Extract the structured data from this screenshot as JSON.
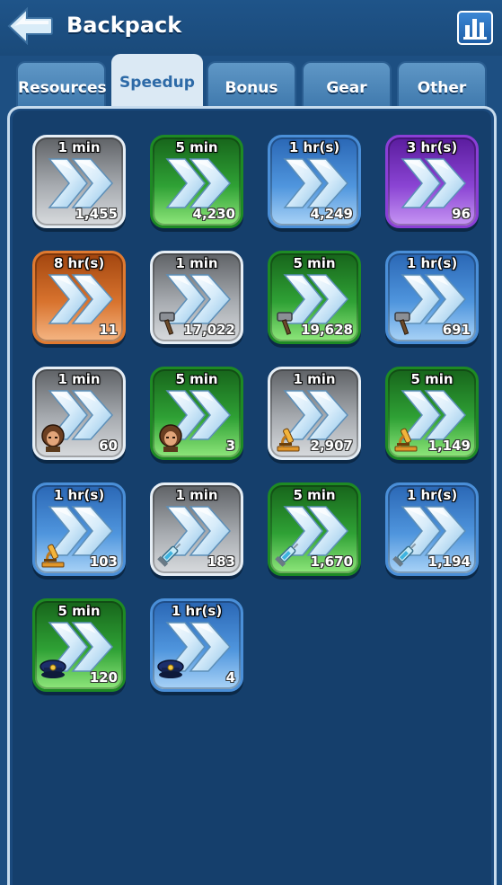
{
  "header": {
    "title": "Backpack",
    "back_icon": "back-arrow-icon",
    "stats_icon": "bar-chart-icon"
  },
  "tabs": [
    {
      "label": "Resources",
      "active": false
    },
    {
      "label": "Speedup",
      "active": true
    },
    {
      "label": "Bonus",
      "active": false
    },
    {
      "label": "Gear",
      "active": false
    },
    {
      "label": "Other",
      "active": false
    }
  ],
  "colors": {
    "gray": "#a7abb0",
    "green": "#2fa135",
    "blue": "#4f95dd",
    "purple": "#8a44d3",
    "orange": "#d8732e",
    "background": "#153f6c"
  },
  "items": [
    {
      "duration": "1 min",
      "quantity": "1,455",
      "rarity": "gray",
      "type": "general"
    },
    {
      "duration": "5 min",
      "quantity": "4,230",
      "rarity": "green",
      "type": "general"
    },
    {
      "duration": "1 hr(s)",
      "quantity": "4,249",
      "rarity": "blue",
      "type": "general"
    },
    {
      "duration": "3 hr(s)",
      "quantity": "96",
      "rarity": "purple",
      "type": "general"
    },
    {
      "duration": "8 hr(s)",
      "quantity": "11",
      "rarity": "orange",
      "type": "general"
    },
    {
      "duration": "1 min",
      "quantity": "17,022",
      "rarity": "gray",
      "type": "hammer"
    },
    {
      "duration": "5 min",
      "quantity": "19,628",
      "rarity": "green",
      "type": "hammer"
    },
    {
      "duration": "1 hr(s)",
      "quantity": "691",
      "rarity": "blue",
      "type": "hammer"
    },
    {
      "duration": "1 min",
      "quantity": "60",
      "rarity": "gray",
      "type": "soldier"
    },
    {
      "duration": "5 min",
      "quantity": "3",
      "rarity": "green",
      "type": "soldier"
    },
    {
      "duration": "1 min",
      "quantity": "2,907",
      "rarity": "gray",
      "type": "microscope"
    },
    {
      "duration": "5 min",
      "quantity": "1,149",
      "rarity": "green",
      "type": "microscope"
    },
    {
      "duration": "1 hr(s)",
      "quantity": "103",
      "rarity": "blue",
      "type": "microscope"
    },
    {
      "duration": "1 min",
      "quantity": "183",
      "rarity": "gray",
      "type": "syringe"
    },
    {
      "duration": "5 min",
      "quantity": "1,670",
      "rarity": "green",
      "type": "syringe"
    },
    {
      "duration": "1 hr(s)",
      "quantity": "1,194",
      "rarity": "blue",
      "type": "syringe"
    },
    {
      "duration": "5 min",
      "quantity": "120",
      "rarity": "green",
      "type": "officer-cap"
    },
    {
      "duration": "1 hr(s)",
      "quantity": "4",
      "rarity": "blue",
      "type": "officer-cap"
    }
  ]
}
